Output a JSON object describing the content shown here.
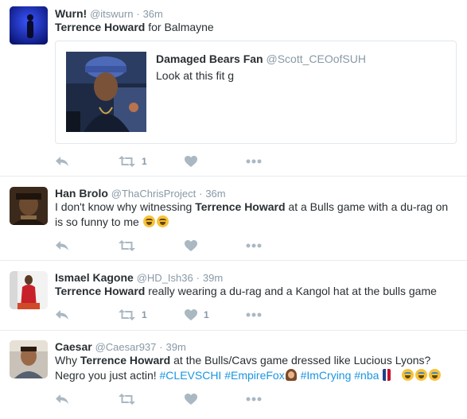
{
  "tweets": [
    {
      "name": "Wurn!",
      "handle": "@itswurn",
      "sep": "·",
      "time": "36m",
      "text_bold": "Terrence Howard",
      "text_rest": " for Balmayne",
      "quote": {
        "name": "Damaged Bears Fan",
        "handle": "@Scott_CEOofSUH",
        "text": "Look at this fit g"
      },
      "retweets": "1",
      "likes": ""
    },
    {
      "name": "Han Brolo",
      "handle": "@ThaChrisProject",
      "sep": "·",
      "time": "36m",
      "text_pre": "I don't know why witnessing ",
      "text_bold": "Terrence Howard",
      "text_post": " at a Bulls game with a du-rag on is so funny to me",
      "retweets": "",
      "likes": ""
    },
    {
      "name": "Ismael Kagone",
      "handle": "@HD_Ish36",
      "sep": "·",
      "time": "39m",
      "text_bold": "Terrence Howard",
      "text_rest": " really wearing a du-rag and a Kangol hat at the bulls game",
      "retweets": "1",
      "likes": "1"
    },
    {
      "name": "Caesar",
      "handle": "@Caesar937",
      "sep": "·",
      "time": "39m",
      "text_pre": "Why ",
      "text_bold": "Terrence Howard",
      "text_post": " at the Bulls/Cavs game dressed like Lucious Lyons? Negro you just actin! ",
      "hashtags": [
        "#CLEVSCHI",
        "#EmpireFox",
        "#ImCrying",
        "#nba"
      ],
      "retweets": "",
      "likes": ""
    }
  ],
  "icons": {
    "reply": "reply-icon",
    "retweet": "retweet-icon",
    "like": "heart-icon",
    "more": "more-dots-icon"
  },
  "colors": {
    "link": "#1b95e0",
    "muted": "#8899a6",
    "icon": "#aab8c2",
    "divider": "#e6ecf0"
  }
}
